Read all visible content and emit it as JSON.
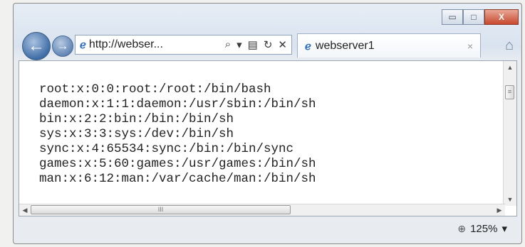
{
  "browser": {
    "address": "http://webser...",
    "address_tools": [
      "search-icon",
      "dropdown-icon",
      "compatibility-icon",
      "refresh-icon",
      "stop-icon"
    ],
    "tab_title": "webserver1",
    "tab_close": "×"
  },
  "window_controls": {
    "minimize": "▭",
    "maximize": "□",
    "close": "X"
  },
  "content": {
    "lines": [
      "root:x:0:0:root:/root:/bin/bash",
      "daemon:x:1:1:daemon:/usr/sbin:/bin/sh",
      "bin:x:2:2:bin:/bin:/bin/sh",
      "sys:x:3:3:sys:/dev:/bin/sh",
      "sync:x:4:65534:sync:/bin:/bin/sync",
      "games:x:5:60:games:/usr/games:/bin/sh",
      "man:x:6:12:man:/var/cache/man:/bin/sh"
    ]
  },
  "status": {
    "zoom": "125%"
  }
}
